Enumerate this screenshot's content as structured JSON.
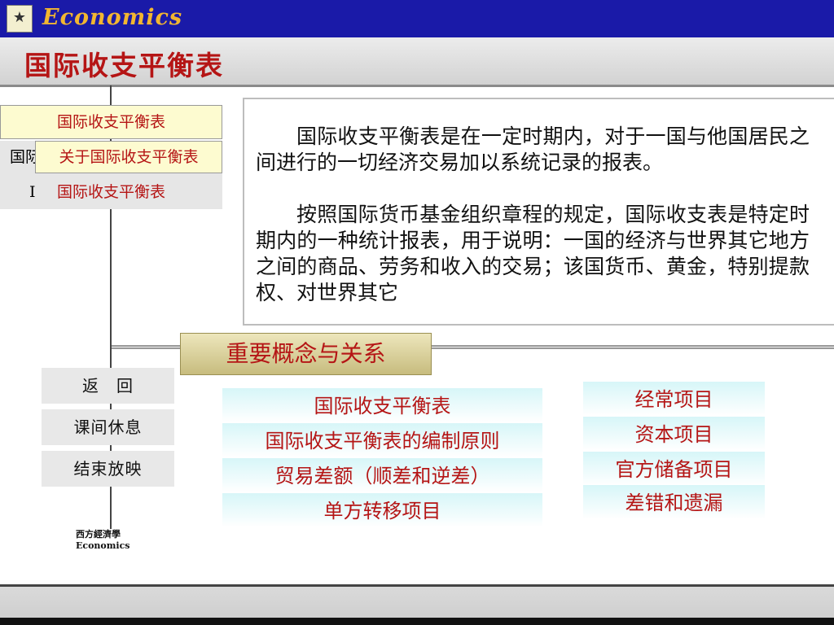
{
  "header": {
    "logo_icon": "★",
    "title": "Economics"
  },
  "page_title": "国际收支平衡表",
  "nav": {
    "item1": "国际收支平衡表",
    "item2_base": "国际",
    "item2_popup": "关于国际收支平衡表",
    "item3_stub": "I",
    "item3": "国际收支平衡表"
  },
  "content": {
    "paragraphs": [
      "国际收支平衡表是在一定时期内，对于一国与他国居民之间进行的一切经济交易加以系统记录的报表。",
      "按照国际货币基金组织章程的规定，国际收支表是特定时期内的一种统计报表，用于说明：一国的经济与世界其它地方之间的商品、劳务和收入的交易；该国货币、黄金，特别提款权、对世界其它"
    ]
  },
  "concepts": {
    "title": "重要概念与关系",
    "left_links": [
      "国际收支平衡表",
      "国际收支平衡表的编制原则",
      "贸易差额（顺差和逆差）",
      "单方转移项目"
    ],
    "right_links": [
      "经常项目",
      "资本项目",
      "官方储备项目",
      "差错和遗漏"
    ]
  },
  "side_buttons": {
    "back": "返　回",
    "break": "课间休息",
    "end": "结束放映"
  },
  "book_logo": {
    "line1": "西方經濟學",
    "line2": "Economics"
  },
  "colors": {
    "banner": "#1a1aa8",
    "banner_title": "#f2b631",
    "accent_red": "#b51515"
  }
}
